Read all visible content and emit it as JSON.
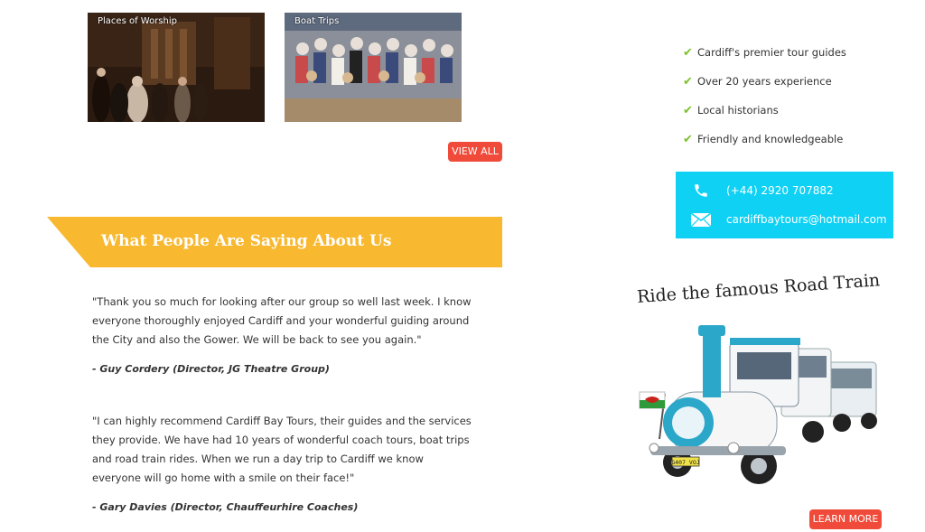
{
  "gallery": {
    "tiles": [
      {
        "label": "Places of Worship"
      },
      {
        "label": "Boat Trips"
      }
    ],
    "view_all_label": "VIEW ALL"
  },
  "features": [
    "Cardiff's premier tour guides",
    "Over 20 years experience",
    "Local historians",
    "Friendly and knowledgeable"
  ],
  "contact": {
    "phone": "(+44) 2920 707882",
    "email": "cardiffbaytours@hotmail.com",
    "background_color": "#0fd1f4",
    "phone_icon": "phone-icon",
    "email_icon": "envelope-icon"
  },
  "testimonials": {
    "heading": "What People Are Saying About Us",
    "banner_color": "#f8b930",
    "items": [
      {
        "quote": "\"Thank you so much for looking after our group so well last week. I know everyone thoroughly enjoyed Cardiff and your wonderful guiding around the City and also the Gower. We will be back to see you again.\"",
        "author": "- Guy Cordery (Director, JG Theatre Group)"
      },
      {
        "quote": "\"I can highly recommend Cardiff Bay Tours, their guides and the services they provide. We have had 10 years of wonderful coach tours, boat trips and road train rides. When we run a day trip to Cardiff we know everyone will go home with a smile on their face!\"",
        "author": "- Gary Davies (Director, Chauffeurhire Coaches)"
      }
    ]
  },
  "road_train": {
    "title": "Ride the famous Road Train",
    "learn_more_label": "LEARN MORE",
    "plate_text": "G407 VOJ"
  },
  "colors": {
    "button_red": "#f04b3a",
    "check_green": "#7cc12a"
  }
}
